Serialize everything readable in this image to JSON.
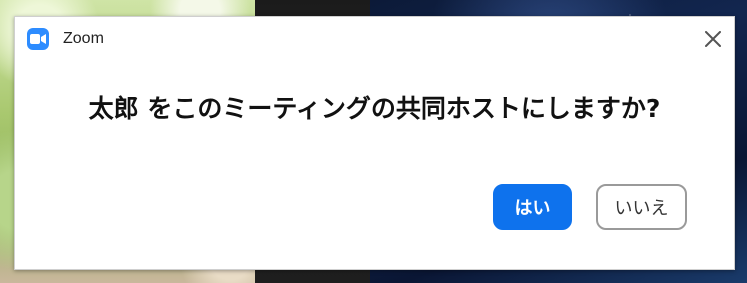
{
  "window": {
    "app_title": "Zoom",
    "icons": {
      "app": "zoom-camera-icon",
      "close": "close-icon"
    },
    "accent_color": "#0e72ed",
    "logo_color": "#2d8cff"
  },
  "dialog": {
    "message": "太郎 をこのミーティングの共同ホストにしますか?",
    "buttons": {
      "yes_label": "はい",
      "no_label": "いいえ"
    }
  }
}
